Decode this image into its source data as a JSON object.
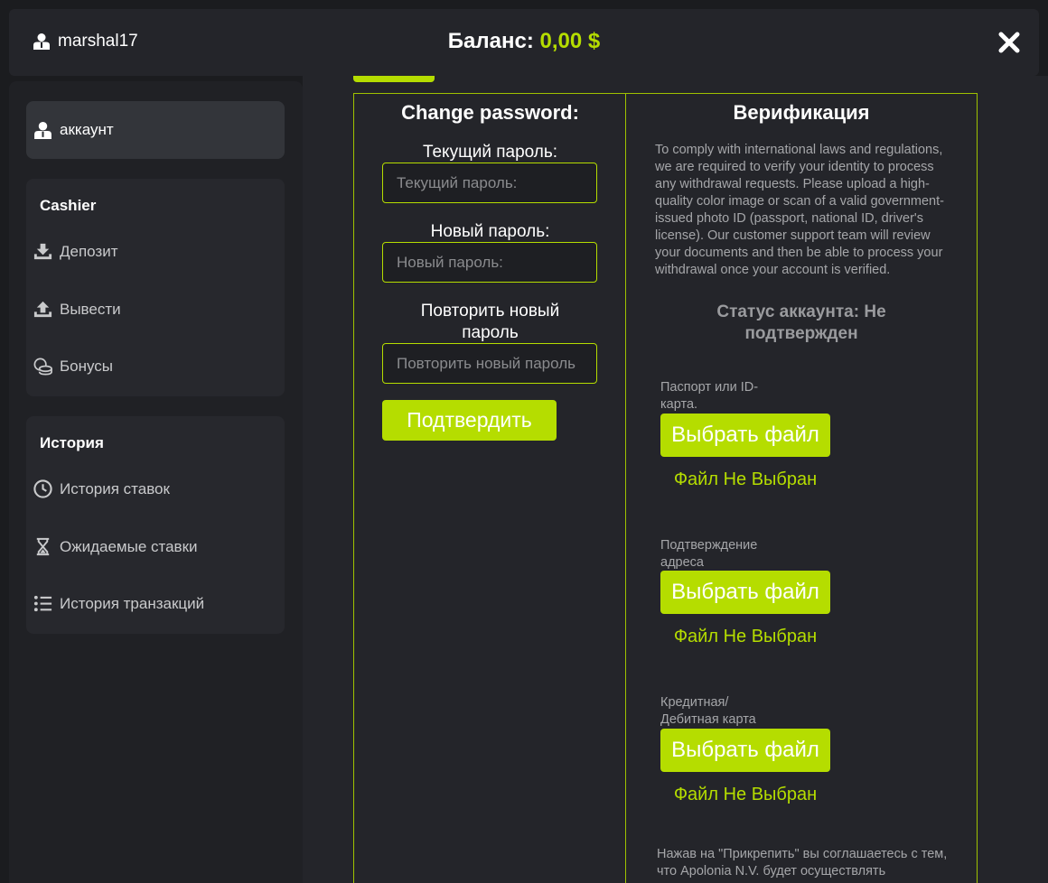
{
  "header": {
    "username": "marshal17",
    "balance_label": "Баланс:",
    "balance_value": "0,00 $"
  },
  "sidebar": {
    "account_label": "аккаунт",
    "cashier": {
      "title": "Cashier",
      "items": [
        {
          "label": "Депозит",
          "icon": "deposit-icon"
        },
        {
          "label": "Вывести",
          "icon": "withdraw-icon"
        },
        {
          "label": "Бонусы",
          "icon": "coins-icon"
        }
      ]
    },
    "history": {
      "title": "История",
      "items": [
        {
          "label": "История ставок",
          "icon": "clock-icon"
        },
        {
          "label": "Ожидаемые ставки",
          "icon": "hourglass-icon"
        },
        {
          "label": "История транзакций",
          "icon": "list-icon"
        }
      ]
    }
  },
  "password": {
    "title": "Change password:",
    "current_label": "Текущий пароль:",
    "current_placeholder": "Текущий пароль:",
    "new_label": "Новый пароль:",
    "new_placeholder": "Новый пароль:",
    "repeat_label": "Повторить новый пароль",
    "repeat_placeholder": "Повторить новый пароль",
    "submit": "Подтвердить"
  },
  "verification": {
    "title": "Верификация",
    "text": "To comply with international laws and regulations, we are required to verify your identity to process any withdrawal requests. Please upload a high-quality color image or scan of a valid government-issued photo ID (passport, national ID, driver's license). Our customer support team will review your documents and then be able to process your withdrawal once your account is verified.",
    "status": "Статус аккаунта: Не подтвержден",
    "documents": [
      {
        "label": "Паспорт или ID-карта.",
        "button": "Выбрать файл",
        "file_status": "Файл Не Выбран"
      },
      {
        "label": "Подтверждение адреса",
        "button": "Выбрать файл",
        "file_status": "Файл Не Выбран"
      },
      {
        "label": "Кредитная/ Дебитная карта",
        "button": "Выбрать файл",
        "file_status": "Файл Не Выбран"
      }
    ],
    "agreement": "Нажав на \"Прикрепить\" вы соглашаетесь с тем, что Apolonia N.V. будет осуществлять"
  },
  "colors": {
    "accent": "#b5dd00",
    "background": "#1b1c1f",
    "panel": "#24252a"
  }
}
